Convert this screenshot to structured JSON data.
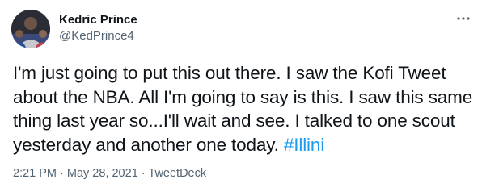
{
  "user": {
    "display_name": "Kedric Prince",
    "handle": "@KedPrince4",
    "avatar_icon": "profile-photo"
  },
  "more_icon": "more-horizontal-icon",
  "tweet": {
    "text": "I'm just going to put this out there. I saw the Kofi Tweet about the NBA. All I'm going to say is this. I saw this same thing last year so...I'll wait and see. I talked to one scout yesterday and another one today. ",
    "hashtag": "#Illini"
  },
  "meta": {
    "time": "2:21 PM",
    "separator": " · ",
    "date": "May 28, 2021",
    "source": "TweetDeck"
  },
  "colors": {
    "text": "#0f1419",
    "secondary": "#536471",
    "link": "#1d9bf0"
  }
}
